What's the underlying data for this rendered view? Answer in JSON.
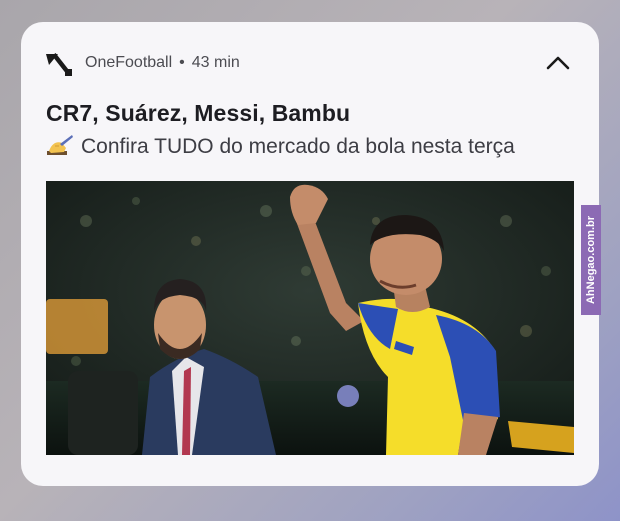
{
  "notification": {
    "app_name": "OneFootball",
    "separator": "•",
    "time": "43 min",
    "title": "CR7, Suárez, Messi, Bambu",
    "subtitle": "Confira TUDO do mercado da bola nesta terça",
    "emoji": "writing-hand-emoji",
    "logo_icon": "onefootball-logo-icon",
    "collapse_icon": "chevron-up-icon"
  },
  "watermark": "AhNegao.com.br",
  "colors": {
    "card": "#f7f6f9",
    "title": "#1d1d22",
    "meta": "#4c4c52",
    "jersey_yellow": "#f5dd2a",
    "jersey_blue": "#2c4fb5",
    "watermark_bg": "#8c6ab4"
  }
}
